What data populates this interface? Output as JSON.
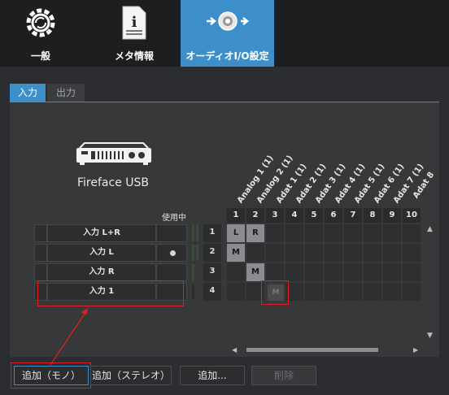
{
  "toolbar": {
    "items": [
      {
        "label": "一般",
        "icon": "gear-icon"
      },
      {
        "label": "メタ情報",
        "icon": "info-document-icon"
      },
      {
        "label": "オーディオI/O設定",
        "icon": "audio-io-icon"
      }
    ]
  },
  "tabs": [
    {
      "label": "入力"
    },
    {
      "label": "出力"
    }
  ],
  "device": {
    "name": "Fireface USB",
    "icon": "audio-interface-icon"
  },
  "in_use_label": "使用中",
  "columns": {
    "names": [
      "Analog 1 (1)",
      "Analog 2 (1)",
      "Adat 1 (1)",
      "Adat 2 (1)",
      "Adat 3 (1)",
      "Adat 4 (1)",
      "Adat 5 (1)",
      "Adat 6 (1)",
      "Adat 7 (1)",
      "Adat 8"
    ],
    "numbers": [
      "1",
      "2",
      "3",
      "4",
      "5",
      "6",
      "7",
      "8",
      "9",
      "10"
    ]
  },
  "rows": [
    {
      "num": "1",
      "name": "入力 L+R",
      "in_use": false
    },
    {
      "num": "2",
      "name": "入力 L",
      "in_use": true
    },
    {
      "num": "3",
      "name": "入力 R",
      "in_use": false
    },
    {
      "num": "4",
      "name": "入力 1",
      "in_use": false
    }
  ],
  "matrix_labels": {
    "r1c1": "L",
    "r1c2": "R",
    "r2c1": "M",
    "r3c2": "M",
    "r4c3": "M"
  },
  "buttons": {
    "add_mono": "追加（モノ）",
    "add_stereo": "追加（ステレオ）",
    "add": "追加...",
    "delete": "削除"
  },
  "colors": {
    "accent": "#3c8fc9",
    "highlight": "#e02020"
  }
}
